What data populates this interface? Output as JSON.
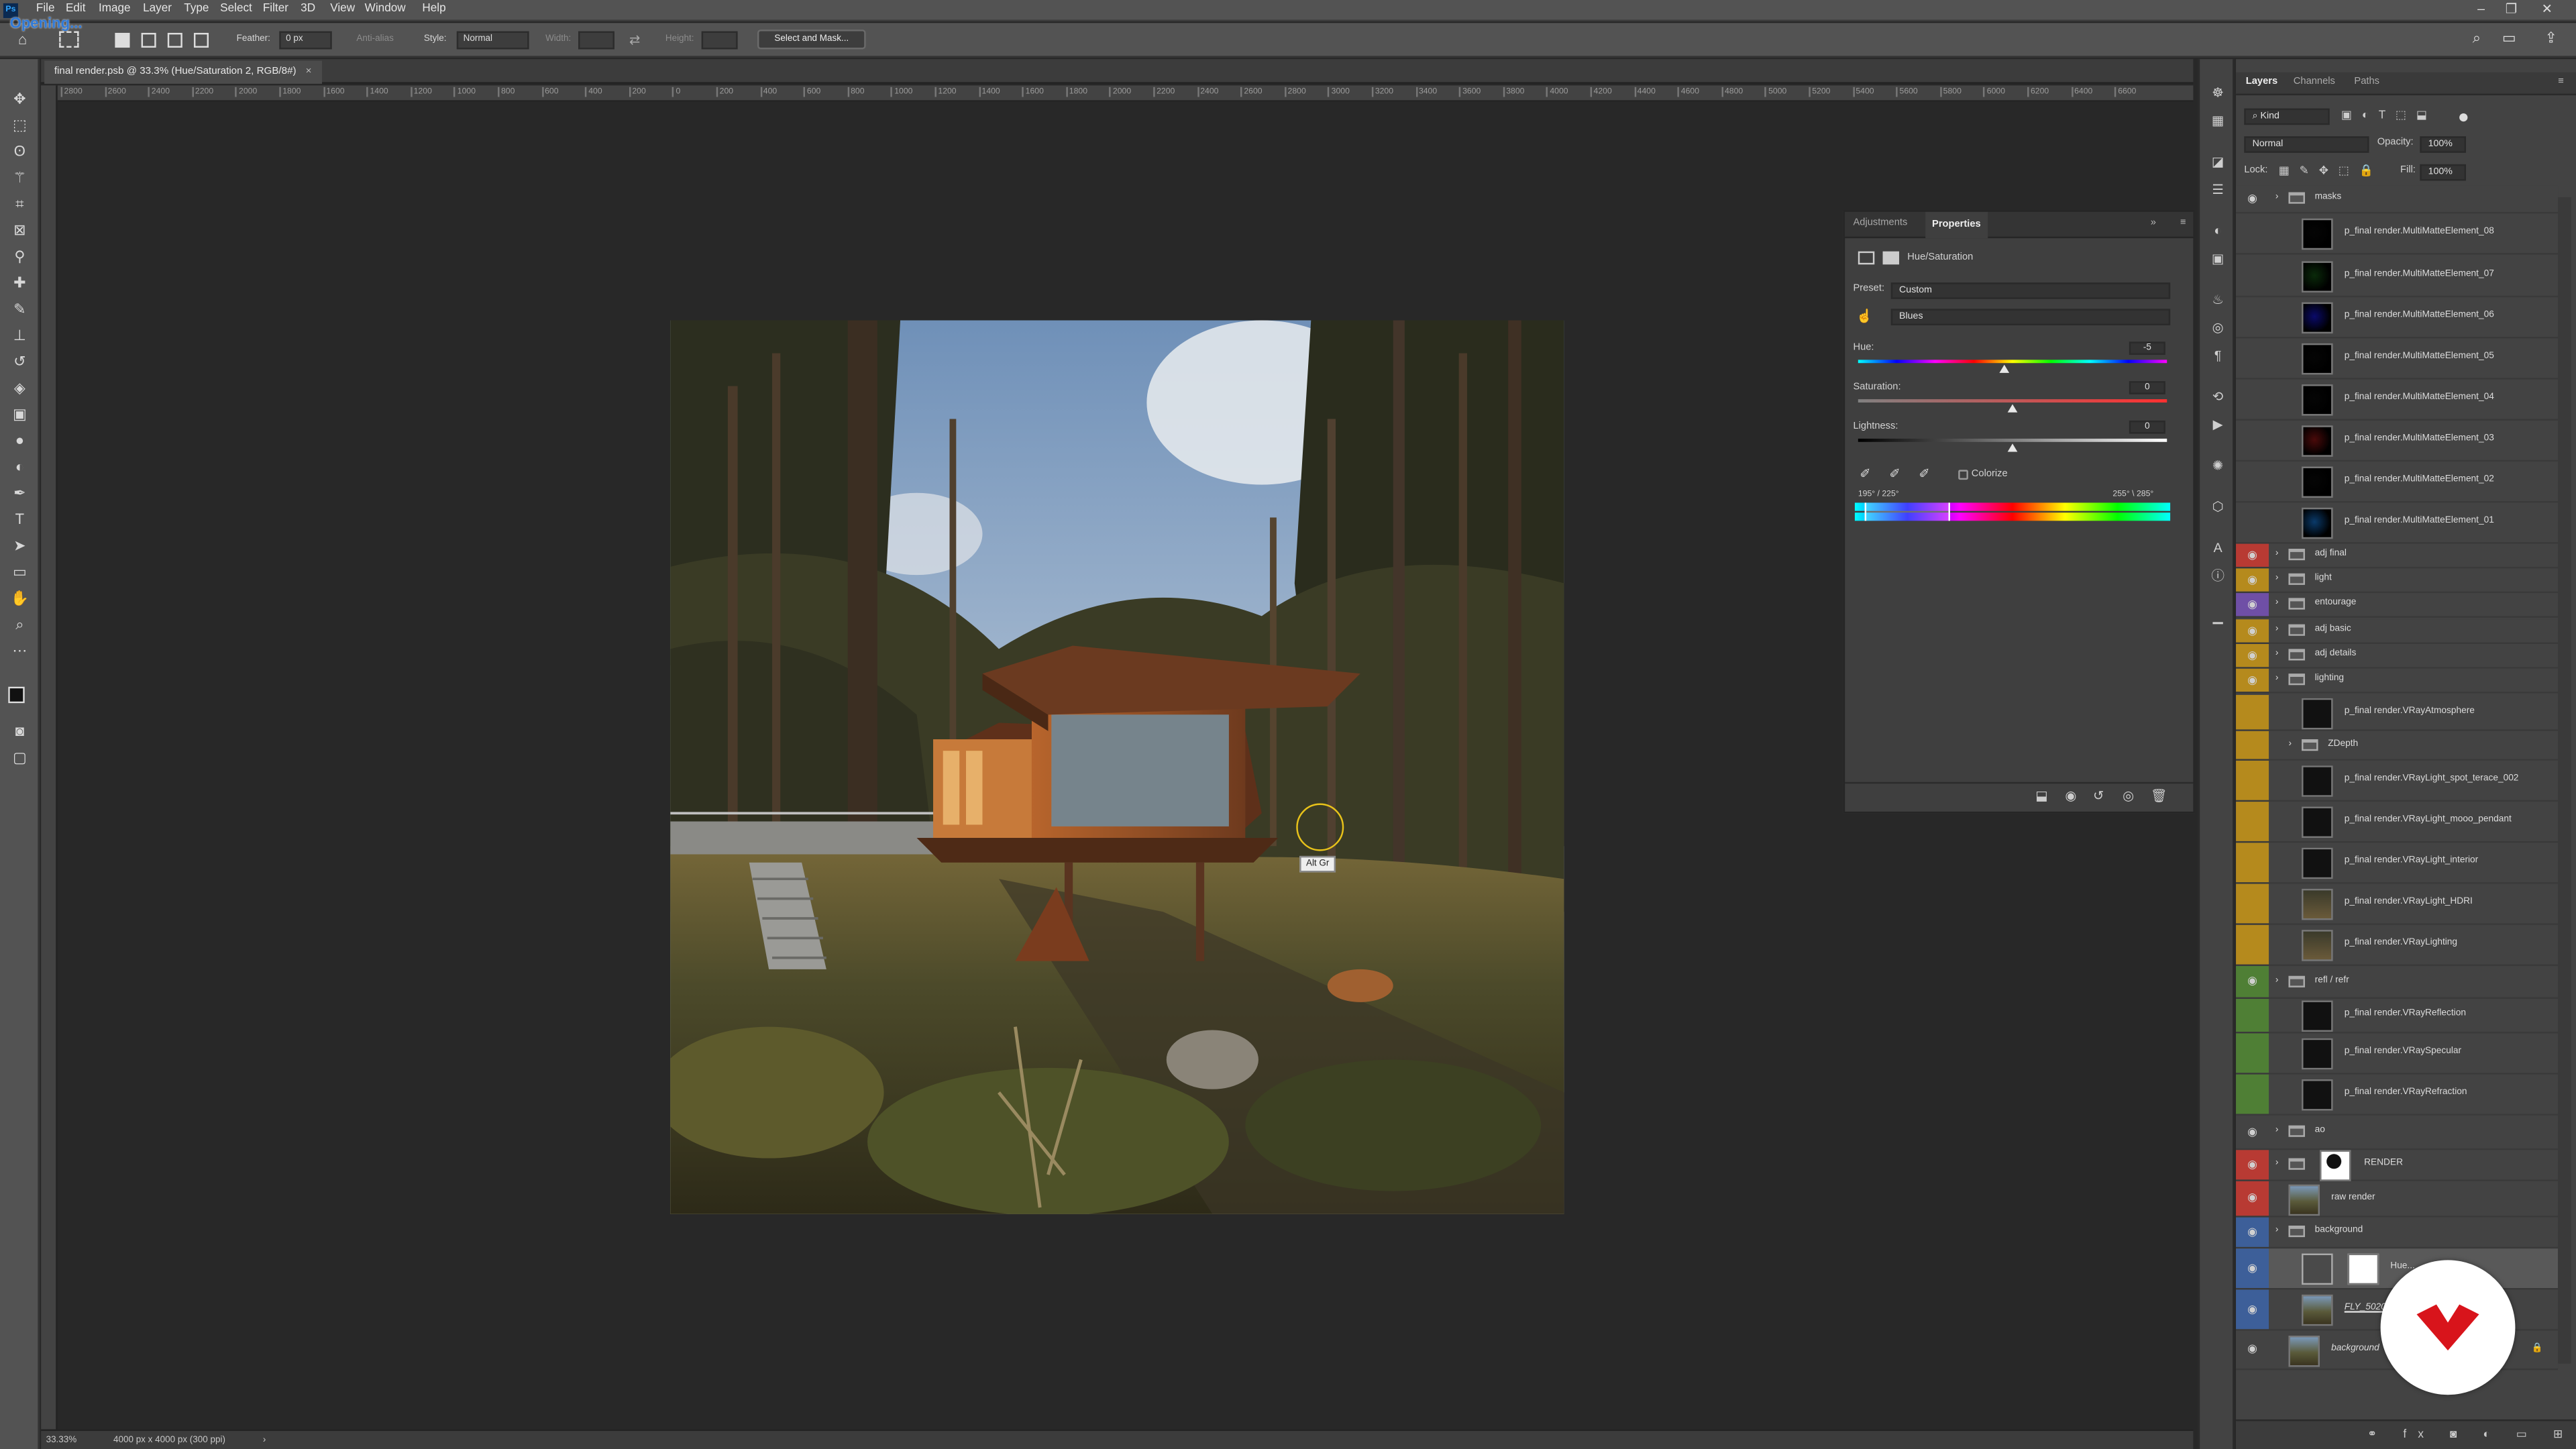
{
  "app": {
    "logo_text": "Ps",
    "status_overlay": "Opening...",
    "menus": [
      "File",
      "Edit",
      "Image",
      "Layer",
      "Type",
      "Select",
      "Filter",
      "3D",
      "View",
      "Window",
      "Help"
    ]
  },
  "options_bar": {
    "feather_label": "Feather:",
    "feather_value": "0 px",
    "antialias_label": "Anti-alias",
    "style_label": "Style:",
    "style_value": "Normal",
    "width_label": "Width:",
    "height_label": "Height:",
    "select_mask_label": "Select and Mask..."
  },
  "document": {
    "tab_title": "final render.psb @ 33.3% (Hue/Saturation 2, RGB/8#)",
    "ruler_ticks": [
      "2800",
      "2600",
      "2400",
      "2200",
      "2000",
      "1800",
      "1600",
      "1400",
      "1200",
      "1000",
      "800",
      "600",
      "400",
      "200",
      "0",
      "200",
      "400",
      "600",
      "800",
      "1000",
      "1200",
      "1400",
      "1600",
      "1800",
      "2000",
      "2200",
      "2400",
      "2600",
      "2800",
      "3000",
      "3200",
      "3400",
      "3600",
      "3800",
      "4000",
      "4200",
      "4400",
      "4600",
      "4800",
      "5000",
      "5200",
      "5400",
      "5600",
      "5800",
      "6000",
      "6200",
      "6400",
      "6600"
    ],
    "tooltip": "Alt Gr",
    "zoom": "33.33%",
    "doc_info": "4000 px x 4000 px (300 ppi)"
  },
  "properties": {
    "tab_adjustments": "Adjustments",
    "tab_properties": "Properties",
    "adjustment_name": "Hue/Saturation",
    "preset_label": "Preset:",
    "preset_value": "Custom",
    "channel_value": "Blues",
    "hue_label": "Hue:",
    "hue_value": "-5",
    "saturation_label": "Saturation:",
    "saturation_value": "0",
    "lightness_label": "Lightness:",
    "lightness_value": "0",
    "colorize_label": "Colorize",
    "range_left": "195° / 225°",
    "range_right": "255° \\ 285°"
  },
  "layers_panel": {
    "tabs": [
      "Layers",
      "Channels",
      "Paths"
    ],
    "kind_filter": "Kind",
    "blend_mode": "Normal",
    "opacity_label": "Opacity:",
    "opacity_value": "100%",
    "lock_label": "Lock:",
    "fill_label": "Fill:",
    "fill_value": "100%",
    "layers": [
      {
        "name": "masks",
        "type": "group",
        "indent": 0,
        "tag": "none",
        "visible": true
      },
      {
        "name": "p_final render.MultiMatteElement_08",
        "type": "layer",
        "indent": 1,
        "tag": "none",
        "visible": false
      },
      {
        "name": "p_final render.MultiMatteElement_07",
        "type": "layer",
        "indent": 1,
        "tag": "none",
        "visible": false
      },
      {
        "name": "p_final render.MultiMatteElement_06",
        "type": "layer",
        "indent": 1,
        "tag": "none",
        "visible": false
      },
      {
        "name": "p_final render.MultiMatteElement_05",
        "type": "layer",
        "indent": 1,
        "tag": "none",
        "visible": false
      },
      {
        "name": "p_final render.MultiMatteElement_04",
        "type": "layer",
        "indent": 1,
        "tag": "none",
        "visible": false
      },
      {
        "name": "p_final render.MultiMatteElement_03",
        "type": "layer",
        "indent": 1,
        "tag": "none",
        "visible": false
      },
      {
        "name": "p_final render.MultiMatteElement_02",
        "type": "layer",
        "indent": 1,
        "tag": "none",
        "visible": false
      },
      {
        "name": "p_final render.MultiMatteElement_01",
        "type": "layer",
        "indent": 1,
        "tag": "none",
        "visible": false
      },
      {
        "name": "adj final",
        "type": "group",
        "indent": 0,
        "tag": "red",
        "visible": true
      },
      {
        "name": "light",
        "type": "group",
        "indent": 0,
        "tag": "yellow",
        "visible": true
      },
      {
        "name": "entourage",
        "type": "group",
        "indent": 0,
        "tag": "violet",
        "visible": true
      },
      {
        "name": "adj basic",
        "type": "group",
        "indent": 0,
        "tag": "yellow",
        "visible": true
      },
      {
        "name": "adj details",
        "type": "group",
        "indent": 0,
        "tag": "yellow",
        "visible": true
      },
      {
        "name": "lighting",
        "type": "group",
        "indent": 0,
        "tag": "yellow",
        "visible": true
      },
      {
        "name": "p_final render.VRayAtmosphere",
        "type": "layer",
        "indent": 1,
        "tag": "yellow",
        "visible": false
      },
      {
        "name": "ZDepth",
        "type": "group",
        "indent": 1,
        "tag": "yellow",
        "visible": false
      },
      {
        "name": "p_final render.VRayLight_spot_terace_002",
        "type": "layer",
        "indent": 1,
        "tag": "yellow",
        "visible": false
      },
      {
        "name": "p_final render.VRayLight_mooo_pendant",
        "type": "layer",
        "indent": 1,
        "tag": "yellow",
        "visible": false
      },
      {
        "name": "p_final render.VRayLight_interior",
        "type": "layer",
        "indent": 1,
        "tag": "yellow",
        "visible": false
      },
      {
        "name": "p_final render.VRayLight_HDRI",
        "type": "layer",
        "indent": 1,
        "tag": "yellow",
        "visible": false
      },
      {
        "name": "p_final render.VRayLighting",
        "type": "layer",
        "indent": 1,
        "tag": "yellow",
        "visible": false
      },
      {
        "name": "refl / refr",
        "type": "group",
        "indent": 0,
        "tag": "green",
        "visible": true
      },
      {
        "name": "p_final render.VRayReflection",
        "type": "layer",
        "indent": 1,
        "tag": "green",
        "visible": false
      },
      {
        "name": "p_final render.VRaySpecular",
        "type": "layer",
        "indent": 1,
        "tag": "green",
        "visible": false
      },
      {
        "name": "p_final render.VRayRefraction",
        "type": "layer",
        "indent": 1,
        "tag": "green",
        "visible": false
      },
      {
        "name": "ao",
        "type": "group",
        "indent": 0,
        "tag": "none",
        "visible": true
      },
      {
        "name": "RENDER",
        "type": "group",
        "indent": 0,
        "tag": "red",
        "visible": true
      },
      {
        "name": "raw render",
        "type": "layer",
        "indent": 0,
        "tag": "red",
        "visible": true
      },
      {
        "name": "background",
        "type": "group",
        "indent": 0,
        "tag": "blue",
        "visible": true
      },
      {
        "name": "Hue...",
        "type": "adjustment",
        "indent": 1,
        "tag": "blue",
        "visible": true
      },
      {
        "name": "FLY_5020",
        "type": "layer",
        "indent": 1,
        "tag": "blue",
        "visible": true
      },
      {
        "name": "background",
        "type": "layer",
        "indent": 0,
        "tag": "none",
        "visible": true
      }
    ]
  },
  "colors": {
    "ui_bg": "#535353",
    "panel_bg": "#434343",
    "canvas_bg": "#282828",
    "tag_red": "#b83a33",
    "tag_yellow": "#b58a1d",
    "tag_violet": "#6f4fa6",
    "tag_green": "#4f7f35",
    "tag_blue": "#3d5f99",
    "brand_red": "#d8141b",
    "accent_blue": "#31a8ff"
  }
}
